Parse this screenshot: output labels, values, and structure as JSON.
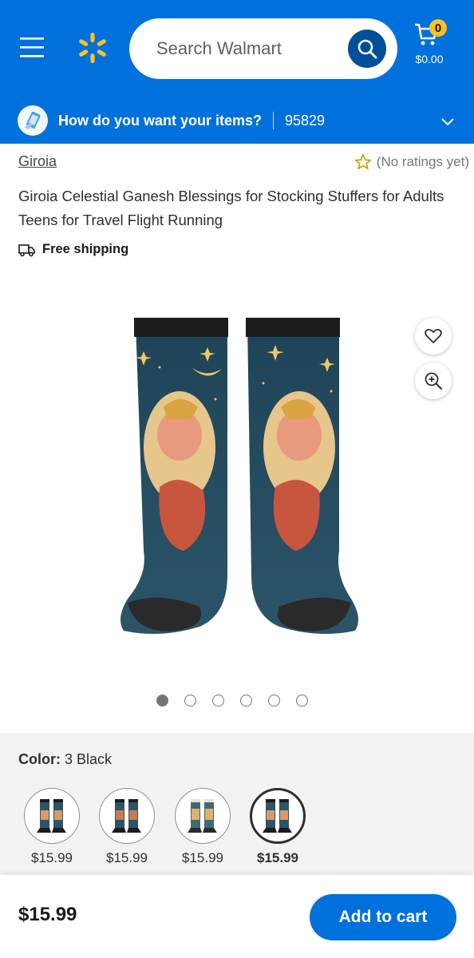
{
  "header": {
    "search_placeholder": "Search Walmart",
    "cart_count": "0",
    "cart_total": "$0.00",
    "brand_color": "#0071dc",
    "spark_color": "#ffc220"
  },
  "delivery": {
    "prompt": "How do you want your items?",
    "zip": "95829"
  },
  "product": {
    "brand": "Giroia",
    "rating_text": "(No ratings yet)",
    "title": "Giroia Celestial Ganesh Blessings for Stocking Stuffers for Adults Teens for Travel Flight Running",
    "shipping": "Free shipping",
    "image_count": 6,
    "active_image": 1
  },
  "variants": {
    "label": "Color:",
    "selected_value": "3 Black",
    "options": [
      {
        "price": "$15.99",
        "selected": false
      },
      {
        "price": "$15.99",
        "selected": false
      },
      {
        "price": "$15.99",
        "selected": false
      },
      {
        "price": "$15.99",
        "selected": true
      }
    ]
  },
  "bottom_bar": {
    "price": "$15.99",
    "add_to_cart": "Add to cart"
  }
}
